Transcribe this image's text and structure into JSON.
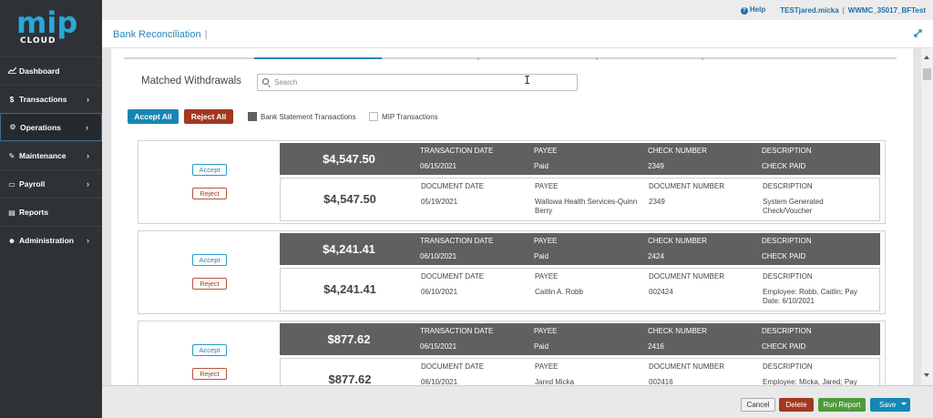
{
  "logo": {
    "mip": "mip",
    "cloud": "CLOUD"
  },
  "sidebar": {
    "items": [
      {
        "label": "Dashboard",
        "icon": "chart-line-icon",
        "glyph": "📈",
        "chevron": ""
      },
      {
        "label": "Transactions",
        "icon": "dollar-icon",
        "glyph": "$",
        "chevron": "›"
      },
      {
        "label": "Operations",
        "icon": "gears-icon",
        "glyph": "⚙",
        "chevron": "›"
      },
      {
        "label": "Maintenance",
        "icon": "wrench-icon",
        "glyph": "✎",
        "chevron": "›"
      },
      {
        "label": "Payroll",
        "icon": "money-icon",
        "glyph": "▭",
        "chevron": "›"
      },
      {
        "label": "Reports",
        "icon": "document-icon",
        "glyph": "▤",
        "chevron": ""
      },
      {
        "label": "Administration",
        "icon": "users-icon",
        "glyph": "☻",
        "chevron": "›"
      }
    ]
  },
  "topbar": {
    "help": "Help",
    "user": "TESTjared.micka",
    "separator": "|",
    "org": "WWMC_35017_BFTest"
  },
  "page": {
    "title": "Bank Reconciliation",
    "title_sep": "|"
  },
  "section": {
    "title": "Matched Withdrawals",
    "search_placeholder": "Search",
    "accept_all": "Accept All",
    "reject_all": "Reject All",
    "legend_bank": "Bank Statement Transactions",
    "legend_mip": "MIP Transactions"
  },
  "labels": {
    "accept": "Accept",
    "reject": "Reject",
    "transaction_date": "TRANSACTION DATE",
    "document_date": "DOCUMENT DATE",
    "payee": "PAYEE",
    "check_number": "CHECK NUMBER",
    "document_number": "DOCUMENT NUMBER",
    "description": "DESCRIPTION"
  },
  "matches": [
    {
      "bank": {
        "amount": "$4,547.50",
        "date": "06/15/2021",
        "payee": "Paid",
        "check": "2349",
        "description": "CHECK PAID"
      },
      "mip": {
        "amount": "$4,547.50",
        "date": "05/19/2021",
        "payee": "Wallowa Health Services-Quinn Berry",
        "document": "2349",
        "description": "System Generated Check/Voucher"
      }
    },
    {
      "bank": {
        "amount": "$4,241.41",
        "date": "06/10/2021",
        "payee": "Paid",
        "check": "2424",
        "description": "CHECK PAID"
      },
      "mip": {
        "amount": "$4,241.41",
        "date": "06/10/2021",
        "payee": "Caitlin A. Robb",
        "document": "002424",
        "description": "Employee: Robb, Caitlin; Pay Date: 6/10/2021"
      }
    },
    {
      "bank": {
        "amount": "$877.62",
        "date": "06/15/2021",
        "payee": "Paid",
        "check": "2416",
        "description": "CHECK PAID"
      },
      "mip": {
        "amount": "$877.62",
        "date": "06/10/2021",
        "payee": "Jared Micka",
        "document": "002416",
        "description": "Employee: Micka, Jared; Pay"
      }
    }
  ],
  "footer": {
    "cancel": "Cancel",
    "delete": "Delete",
    "run_report": "Run Report",
    "save": "Save"
  }
}
